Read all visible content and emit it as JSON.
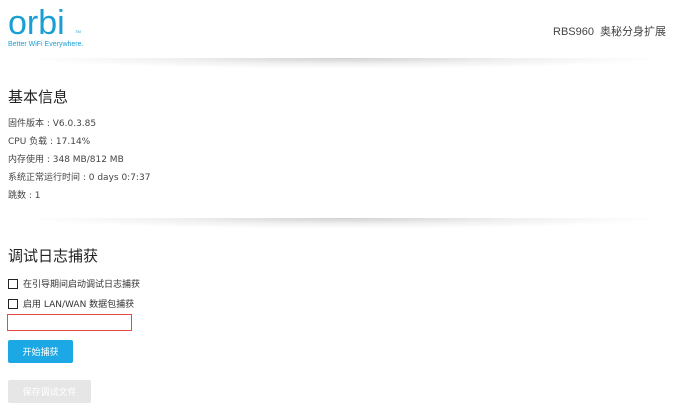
{
  "header": {
    "brand": "orbi",
    "brand_mark": "TM",
    "tagline": "Better WiFi Everywhere.",
    "model": "RBS960",
    "device_label": "奥秘分身扩展"
  },
  "basic_info": {
    "title": "基本信息",
    "firmware": "固件版本 : V6.0.3.85",
    "cpu": "CPU 负载 : 17.14%",
    "memory": "内存使用 : 348 MB/812 MB",
    "uptime": "系统正常运行时间 : 0 days 0:7:37",
    "hops": "跳数 : 1"
  },
  "debug_log": {
    "title": "调试日志捕获",
    "option_boot_capture": "在引导期间启动调试日志捕获",
    "option_lan_wan": "启用 LAN/WAN 数据包捕获",
    "input_value": "",
    "start_button": "开始捕获",
    "save_button": "保存调试文件"
  },
  "colors": {
    "brand": "#1a9fd4",
    "primary_button": "#1ba8e4",
    "error_border": "#e34a4a",
    "disabled_button": "#e6e6e6"
  }
}
